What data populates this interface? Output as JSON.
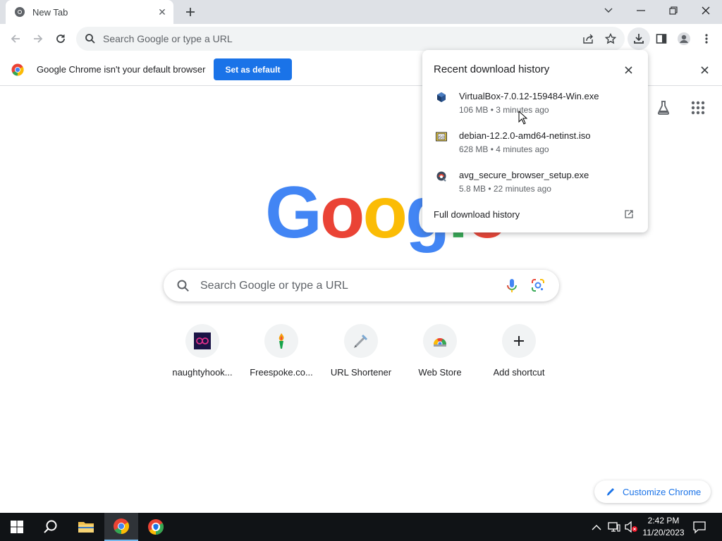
{
  "tab": {
    "title": "New Tab",
    "close_label": "✕",
    "new_tab_label": "+"
  },
  "window": {
    "list_icon": "chevron-down-icon",
    "minimize_icon": "minimize-icon",
    "restore_icon": "restore-icon",
    "close_icon": "close-icon"
  },
  "toolbar": {
    "omnibox_placeholder": "Search Google or type a URL",
    "icons": [
      "back-icon",
      "forward-icon",
      "reload-icon",
      "search-icon",
      "share-icon",
      "bookmark-star-icon",
      "download-icon",
      "side-panel-icon",
      "profile-icon",
      "menu-icon"
    ]
  },
  "infobar": {
    "message": "Google Chrome isn't your default browser",
    "button": "Set as default",
    "close_label": "✕"
  },
  "logo": {
    "letters": [
      "G",
      "o",
      "o",
      "g",
      "l",
      "e"
    ],
    "colors": [
      "#4285f4",
      "#ea4335",
      "#fbbc05",
      "#4285f4",
      "#34a853",
      "#ea4335"
    ]
  },
  "search": {
    "placeholder": "Search Google or type a URL"
  },
  "shortcuts": [
    {
      "label": "naughtyhook...",
      "icon": "naughtyhook-icon"
    },
    {
      "label": "Freespoke.co...",
      "icon": "freespoke-torch-icon"
    },
    {
      "label": "URL Shortener",
      "icon": "url-shortener-icon"
    },
    {
      "label": "Web Store",
      "icon": "web-store-icon"
    },
    {
      "label": "Add shortcut",
      "icon": "plus-icon"
    }
  ],
  "customize": {
    "label": "Customize Chrome"
  },
  "downloads": {
    "title": "Recent download history",
    "items": [
      {
        "name": "VirtualBox-7.0.12-159484-Win.exe",
        "status": "106 MB • 3 minutes ago",
        "icon": "virtualbox-icon"
      },
      {
        "name": "debian-12.2.0-amd64-netinst.iso",
        "status": "628 MB • 4 minutes ago",
        "icon": "iso-file-icon"
      },
      {
        "name": "avg_secure_browser_setup.exe",
        "status": "5.8 MB • 22 minutes ago",
        "icon": "avg-setup-icon"
      }
    ],
    "full_history": "Full download history"
  },
  "taskbar": {
    "time": "2:42 PM",
    "date": "11/20/2023"
  },
  "colors": {
    "accent": "#1a73e8",
    "tabstrip": "#dee1e6",
    "taskbar": "#101316"
  }
}
